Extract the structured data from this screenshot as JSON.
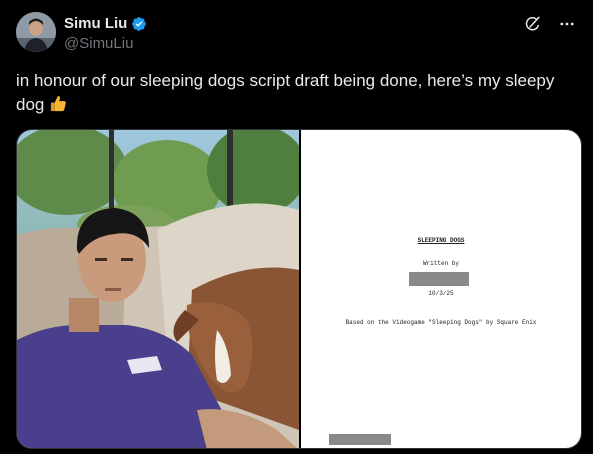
{
  "author": {
    "display_name": "Simu Liu",
    "handle": "@SimuLiu"
  },
  "tweet": {
    "text": "in honour of our sleeping dogs script draft being done, here’s my sleepy dog"
  },
  "document": {
    "title": "SLEEPING DOGS",
    "written_by": "Written by",
    "date": "10/3/25",
    "based_on": "Based on the Videogame \"Sleeping Dogs\" by Square Enix"
  },
  "icons": {
    "verified": "verified-badge-icon",
    "grok": "grok-icon",
    "more": "more-icon",
    "emoji": "thumbs-up-emoji"
  },
  "colors": {
    "background": "#000000",
    "text": "#e7e9ea",
    "muted": "#71767b",
    "verified": "#1d9bf0"
  }
}
